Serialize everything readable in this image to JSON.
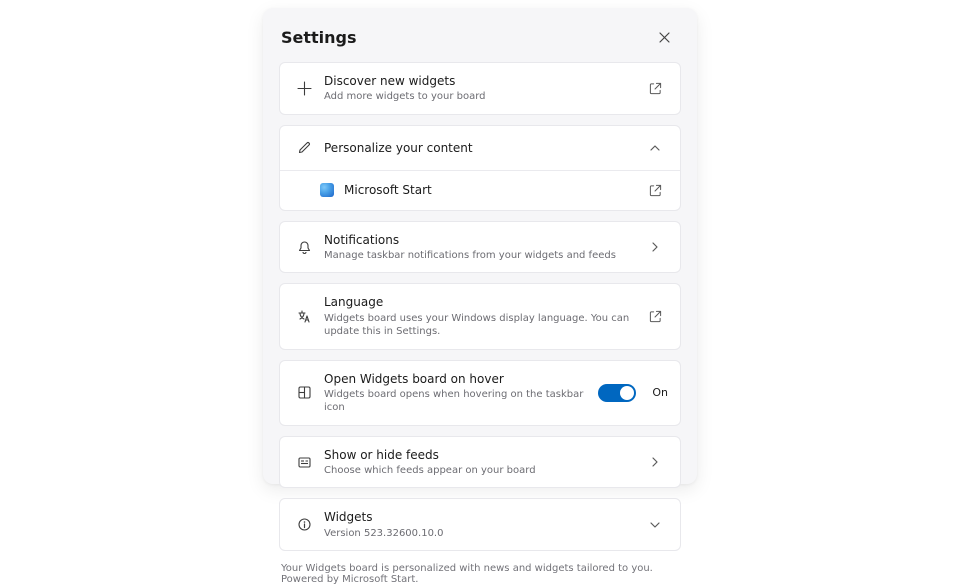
{
  "title": "Settings",
  "items": {
    "discover": {
      "title": "Discover new widgets",
      "sub": "Add more widgets to your board"
    },
    "personalize": {
      "title": "Personalize your content",
      "child": "Microsoft Start"
    },
    "notifications": {
      "title": "Notifications",
      "sub": "Manage taskbar notifications from your widgets and feeds"
    },
    "language": {
      "title": "Language",
      "sub": "Widgets board uses your Windows display language. You can update this in Settings."
    },
    "hover": {
      "title": "Open Widgets board on hover",
      "sub": "Widgets board opens when hovering on the taskbar icon",
      "state": "On"
    },
    "feeds": {
      "title": "Show or hide feeds",
      "sub": "Choose which feeds appear on your board"
    },
    "widgets": {
      "title": "Widgets",
      "sub": "Version 523.32600.10.0"
    }
  },
  "footer": "Your Widgets board is personalized with news and widgets tailored to you. Powered by Microsoft Start."
}
